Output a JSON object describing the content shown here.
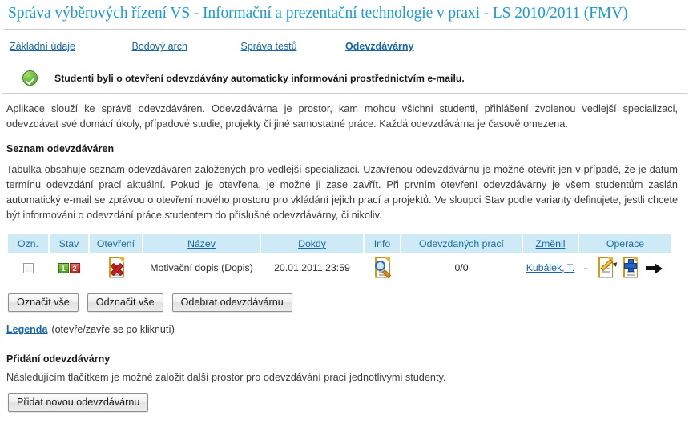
{
  "header": {
    "title": "Správa výběrových řízení VS - Informační a prezentační technologie v praxi - LS 2010/2011 (FMV)"
  },
  "tabs": [
    {
      "label": "Základní údaje",
      "active": false
    },
    {
      "label": "Bodový arch",
      "active": false
    },
    {
      "label": "Správa testů",
      "active": false
    },
    {
      "label": "Odevzdávárny",
      "active": true
    }
  ],
  "notice": {
    "icon": "success-check-icon",
    "text": "Studenti byli o otevření odevzdávány automaticky informováni prostřednictvím e-mailu."
  },
  "intro": {
    "paragraph": "Aplikace slouží ke správě odevzdáváren. Odevzdávárna je prostor, kam mohou všichni studenti, přihlášení zvolenou vedlejší specializaci, odevzdávat své domácí úkoly, případové studie, projekty či jiné samostatné práce. Každá odevzdávárna je časově omezena."
  },
  "list_section": {
    "heading": "Seznam odevzdáváren",
    "description": "Tabulka obsahuje seznam odevzdáváren založených pro vedlejší specializaci. Uzavřenou odevzdávárnu je možné otevřit jen v případě, že je datum termínu odevzdání prací aktuální. Pokud je otevřena, je možné ji zase zavřít. Při prvním otevření odevzdávárny je všem studentům zaslán automatický e-mail se zprávou o otevření nového prostoru pro vkládání jejich prací a projektů. Ve sloupci Stav podle varianty definujete, jestli chcete být informováni o odevzdání práce studentem do příslušné odevzdávárny, či nikoliv."
  },
  "table": {
    "columns": [
      {
        "label": "Ozn.",
        "sortable": false
      },
      {
        "label": "Stav",
        "sortable": false
      },
      {
        "label": "Otevření",
        "sortable": false
      },
      {
        "label": "Název",
        "sortable": true
      },
      {
        "label": "Dokdy",
        "sortable": true
      },
      {
        "label": "Info",
        "sortable": false
      },
      {
        "label": "Odevzdaných prací",
        "sortable": false
      },
      {
        "label": "Změnil",
        "sortable": true
      },
      {
        "label": "Operace",
        "sortable": false
      }
    ],
    "rows": [
      {
        "selected": false,
        "status_badges": [
          {
            "text": "1",
            "color": "green"
          },
          {
            "text": "2",
            "color": "red"
          }
        ],
        "open_icon": "document-closed-red-x-icon",
        "nazev": "Motivační dopis (Dopis)",
        "dokdy": "20.01.2011 23:59",
        "info_icon": "document-preview-magnifier-icon",
        "odevzdanych_praci": "0/0",
        "zmenil": "Kubálek, T.",
        "zmenil_suffix": "-",
        "operace": [
          "document-edit-pencil-icon",
          "document-add-plus-icon",
          "arrow-right-icon"
        ]
      }
    ]
  },
  "table_buttons": [
    {
      "label": "Označit vše"
    },
    {
      "label": "Odznačit vše"
    },
    {
      "label": "Odebrat odevzdávárnu"
    }
  ],
  "legend": {
    "link": "Legenda",
    "note": "(otevře/zavře se po kliknutí)"
  },
  "add_section": {
    "heading": "Přidání odevzdávárny",
    "description": "Následujícím tlačítkem je možné založit další prostor pro odevzdávání prací jednotlivými studenty.",
    "button_label": "Přidat novou odevzdávárnu"
  },
  "colors": {
    "title": "#1b9ad6",
    "link": "#1765a8",
    "table_header_bg": "#cdeaf6",
    "table_header_text": "#1b6fa8",
    "success_green": "#5cb82b",
    "badge_red": "#c21f16"
  }
}
